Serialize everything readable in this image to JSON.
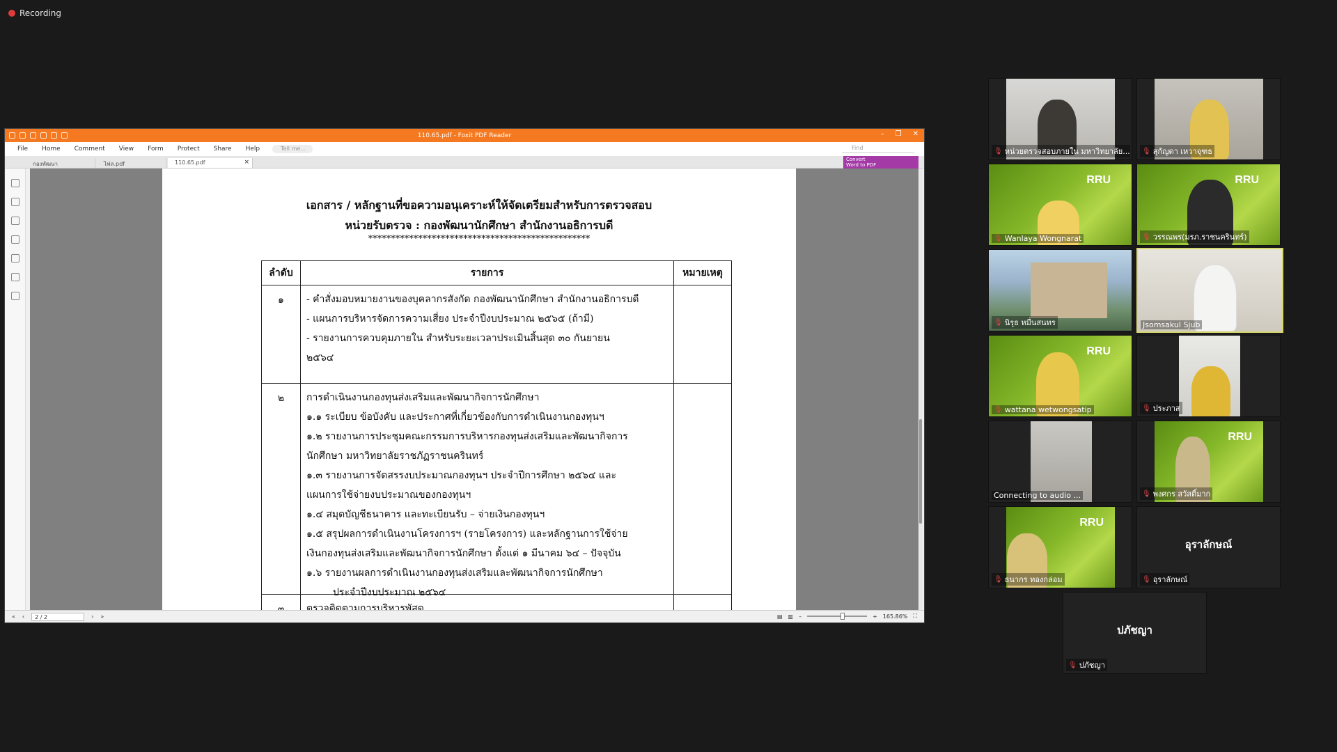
{
  "recording": {
    "label": "Recording"
  },
  "app": {
    "title": "110.65.pdf - Foxit PDF Reader",
    "menu": [
      "File",
      "Home",
      "Comment",
      "View",
      "Form",
      "Protect",
      "Share",
      "Help"
    ],
    "tell_me": "Tell me...",
    "find_placeholder": "Find",
    "tabs": [
      {
        "label": "กองพัฒนานักศึกษา.pdf",
        "active": false
      },
      {
        "label": "ไฟล.pdf",
        "active": false
      },
      {
        "label": "110.65.pdf",
        "active": true
      }
    ],
    "convert": {
      "line1": "Convert",
      "line2": "Word to PDF"
    },
    "page_indicator": "2 / 2",
    "zoom": "165.86%"
  },
  "document": {
    "title_line1": "เอกสาร / หลักฐานที่ขอความอนุเคราะห์ให้จัดเตรียมสำหรับการตรวจสอบ",
    "title_line2": "หน่วยรับตรวจ : กองพัฒนานักศึกษา สำนักงานอธิการบดี",
    "stars": "*************************************************",
    "headers": {
      "col1": "ลำดับ",
      "col2": "รายการ",
      "col3": "หมายเหตุ"
    },
    "rows": [
      {
        "no": "๑",
        "lines": [
          "-  คำสั่งมอบหมายงานของบุคลากรสังกัด กองพัฒนานักศึกษา สำนักงานอธิการบดี",
          "-  แผนการบริหารจัดการความเสี่ยง ประจำปีงบประมาณ  ๒๕๖๕ (ถ้ามี)",
          "-  รายงานการควบคุมภายใน สำหรับระยะเวลาประเมินสิ้นสุด ๓๐ กันยายน",
          "   ๒๕๖๔"
        ]
      },
      {
        "no": "๒",
        "lines": [
          "การดำเนินงานกองทุนส่งเสริมและพัฒนากิจการนักศึกษา",
          "๑.๑  ระเบียบ ข้อบังคับ และประกาศที่เกี่ยวข้องกับการดำเนินงานกองทุนฯ",
          "๑.๒  รายงานการประชุมคณะกรรมการบริหารกองทุนส่งเสริมและพัฒนากิจการ",
          "นักศึกษา มหาวิทยาลัยราชภัฏราชนครินทร์",
          "๑.๓  รายงานการจัดสรรงบประมาณกองทุนฯ ประจำปีการศึกษา ๒๕๖๔ และ",
          "แผนการใช้จ่ายงบประมาณของกองทุนฯ",
          "๑.๔  สมุดบัญชีธนาคาร และทะเบียนรับ – จ่ายเงินกองทุนฯ",
          "๑.๕  สรุปผลการดำเนินงานโครงการฯ (รายโครงการ) และหลักฐานการใช้จ่าย",
          "เงินกองทุนส่งเสริมและพัฒนากิจการนักศึกษา ตั้งแต่ ๑ มีนาคม ๖๔ – ปัจจุบัน",
          "๑.๖  รายงานผลการดำเนินงานกองทุนส่งเสริมและพัฒนากิจการนักศึกษา",
          "ประจำปีงบประมาณ ๒๕๖๔"
        ]
      },
      {
        "no": "๓",
        "lines": [
          "ตรวจติดตามการบริหารพัสดุ"
        ]
      }
    ]
  },
  "participants": [
    {
      "name": "หน่วยตรวจสอบภายใน มหาวิทยาลัย...",
      "muted": true,
      "type": "camera"
    },
    {
      "name": "สุกัญดา  เหวาจุฑธ",
      "muted": true,
      "type": "camera"
    },
    {
      "name": "Wanlaya Wongnarat",
      "muted": true,
      "type": "green"
    },
    {
      "name": "วรรณพร(มรภ.ราชนครินทร์)",
      "muted": true,
      "type": "green"
    },
    {
      "name": "นิรุธ หมื่นสนทร",
      "muted": true,
      "type": "building"
    },
    {
      "name": "Jsomsakul Sjub",
      "muted": false,
      "type": "camera"
    },
    {
      "name": "wattana wetwongsatip",
      "muted": true,
      "type": "green"
    },
    {
      "name": "ประภาส",
      "muted": true,
      "type": "camera"
    },
    {
      "name": "Connecting to audio ...",
      "muted": false,
      "type": "camera"
    },
    {
      "name": "พงศกร สวัสดิ์มาก",
      "muted": true,
      "type": "green"
    },
    {
      "name": "ธนากร ทองกล่อม",
      "muted": true,
      "type": "green"
    },
    {
      "name": "อุราลักษณ์",
      "muted": true,
      "type": "initials",
      "display": "อุราลักษณ์"
    },
    {
      "name": "ปภัชญา",
      "muted": true,
      "type": "initials",
      "display": "ปภัชญา"
    }
  ],
  "colors": {
    "foxit_orange": "#f47920",
    "active_speaker": "#d8d870",
    "muted_red": "#e04848"
  }
}
